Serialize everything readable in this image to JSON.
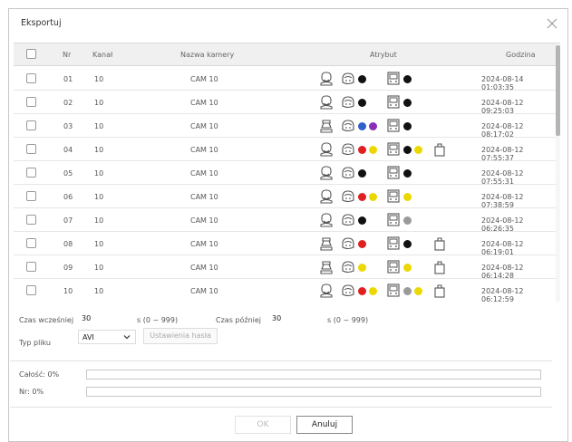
{
  "dialog": {
    "title": "Eksportuj"
  },
  "table": {
    "headers": {
      "nr": "Nr",
      "kanal": "Kanał",
      "nazwa": "Nazwa kamery",
      "atrybut": "Atrybut",
      "godzina": "Godzina"
    },
    "rows": [
      {
        "nr": "01",
        "kanal": "10",
        "nazwa": "CAM 10",
        "godzina": "2024-08-14 01:03:35",
        "attrs": {
          "person": "face",
          "face_colors": [
            "#111111"
          ],
          "vehicle_colors": [
            "#111111"
          ],
          "bag": false
        }
      },
      {
        "nr": "02",
        "kanal": "10",
        "nazwa": "CAM 10",
        "godzina": "2024-08-12 09:25:03",
        "attrs": {
          "person": "face",
          "face_colors": [
            "#111111"
          ],
          "vehicle_colors": [
            "#111111"
          ],
          "bag": false
        }
      },
      {
        "nr": "03",
        "kanal": "10",
        "nazwa": "CAM 10",
        "godzina": "2024-08-12 08:17:02",
        "attrs": {
          "person": "body",
          "face_colors": [
            "#2f5fc8",
            "#8a2fb8"
          ],
          "vehicle_colors": [
            "#111111"
          ],
          "bag": false
        }
      },
      {
        "nr": "04",
        "kanal": "10",
        "nazwa": "CAM 10",
        "godzina": "2024-08-12 07:55:37",
        "attrs": {
          "person": "face",
          "face_colors": [
            "#e02020",
            "#ecd800"
          ],
          "vehicle_colors": [
            "#111111",
            "#ecd800"
          ],
          "bag": true
        }
      },
      {
        "nr": "05",
        "kanal": "10",
        "nazwa": "CAM 10",
        "godzina": "2024-08-12 07:55:31",
        "attrs": {
          "person": "face",
          "face_colors": [
            "#111111"
          ],
          "vehicle_colors": [
            "#111111"
          ],
          "bag": false
        }
      },
      {
        "nr": "06",
        "kanal": "10",
        "nazwa": "CAM 10",
        "godzina": "2024-08-12 07:38:59",
        "attrs": {
          "person": "face",
          "face_colors": [
            "#e02020",
            "#ecd800"
          ],
          "vehicle_colors": [
            "#ecd800"
          ],
          "bag": false
        }
      },
      {
        "nr": "07",
        "kanal": "10",
        "nazwa": "CAM 10",
        "godzina": "2024-08-12 06:26:35",
        "attrs": {
          "person": "face",
          "face_colors": [
            "#111111"
          ],
          "vehicle_colors": [
            "#9a9a9a"
          ],
          "bag": false
        }
      },
      {
        "nr": "08",
        "kanal": "10",
        "nazwa": "CAM 10",
        "godzina": "2024-08-12 06:19:01",
        "attrs": {
          "person": "body",
          "face_colors": [
            "#e02020"
          ],
          "vehicle_colors": [
            "#111111"
          ],
          "bag": true
        }
      },
      {
        "nr": "09",
        "kanal": "10",
        "nazwa": "CAM 10",
        "godzina": "2024-08-12 06:14:28",
        "attrs": {
          "person": "body",
          "face_colors": [
            "#ecd800"
          ],
          "vehicle_colors": [
            "#ecd800"
          ],
          "bag": true
        }
      },
      {
        "nr": "10",
        "kanal": "10",
        "nazwa": "CAM 10",
        "godzina": "2024-08-12 06:12:59",
        "attrs": {
          "person": "face",
          "face_colors": [
            "#e02020",
            "#ecd800"
          ],
          "vehicle_colors": [
            "#9a9a9a",
            "#ecd800"
          ],
          "bag": true
        }
      }
    ]
  },
  "form": {
    "czas_wczesniej_label": "Czas wcześniej",
    "czas_wczesniej_value": "30",
    "czas_wczesniej_range": "s (0 ~ 999)",
    "czas_pozniej_label": "Czas później",
    "czas_pozniej_value": "30",
    "czas_pozniej_range": "s (0 ~ 999)",
    "typ_pliku_label": "Typ pliku",
    "typ_pliku_value": "AVI",
    "ustawienia_hasla": "Ustawienia hasła"
  },
  "progress": {
    "total_label": "Całość: 0%",
    "total_percent": 0,
    "nr_label": "Nr: 0%",
    "nr_percent": 0
  },
  "buttons": {
    "ok": "OK",
    "cancel": "Anuluj"
  }
}
